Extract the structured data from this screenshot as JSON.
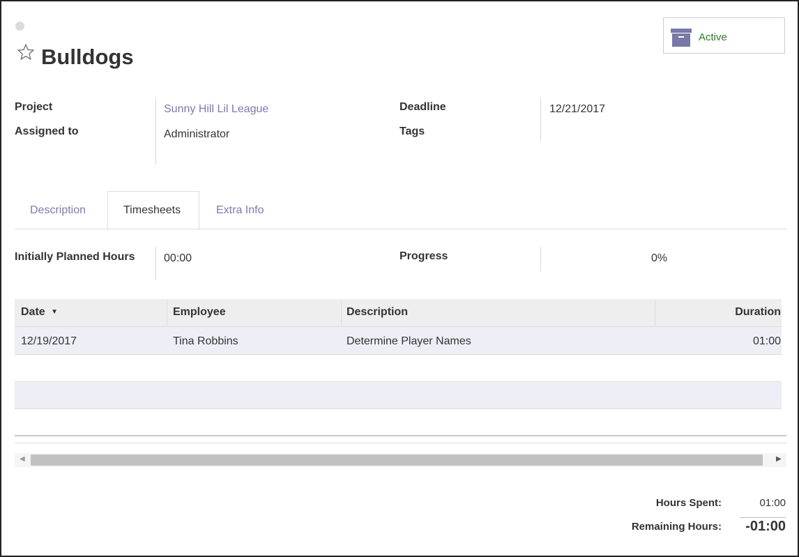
{
  "record": {
    "title": "Bulldogs",
    "status_button": "Active"
  },
  "fields": {
    "project_label": "Project",
    "project_value": "Sunny Hill Lil League",
    "assigned_label": "Assigned to",
    "assigned_value": "Administrator",
    "deadline_label": "Deadline",
    "deadline_value": "12/21/2017",
    "tags_label": "Tags"
  },
  "tabs": [
    {
      "label": "Description",
      "active": false
    },
    {
      "label": "Timesheets",
      "active": true
    },
    {
      "label": "Extra Info",
      "active": false
    }
  ],
  "timesheets": {
    "planned_label": "Initially Planned Hours",
    "planned_value": "00:00",
    "progress_label": "Progress",
    "progress_value": "0%",
    "columns": {
      "date": "Date",
      "employee": "Employee",
      "description": "Description",
      "duration": "Duration"
    },
    "rows": [
      {
        "date": "12/19/2017",
        "employee": "Tina Robbins",
        "description": "Determine Player Names",
        "duration": "01:00"
      }
    ],
    "hours_spent_label": "Hours Spent:",
    "hours_spent_value": "01:00",
    "remaining_label": "Remaining Hours:",
    "remaining_value": "-01:00"
  },
  "colors": {
    "link": "#7c7bad",
    "active_text": "#2c7a2c",
    "archive_icon": "#7a78a8",
    "row_highlight": "#eeeef6"
  },
  "icons": [
    "priority-star-icon",
    "archive-box-icon",
    "sort-caret-icon",
    "scroll-left-arrow-icon",
    "scroll-right-arrow-icon"
  ]
}
